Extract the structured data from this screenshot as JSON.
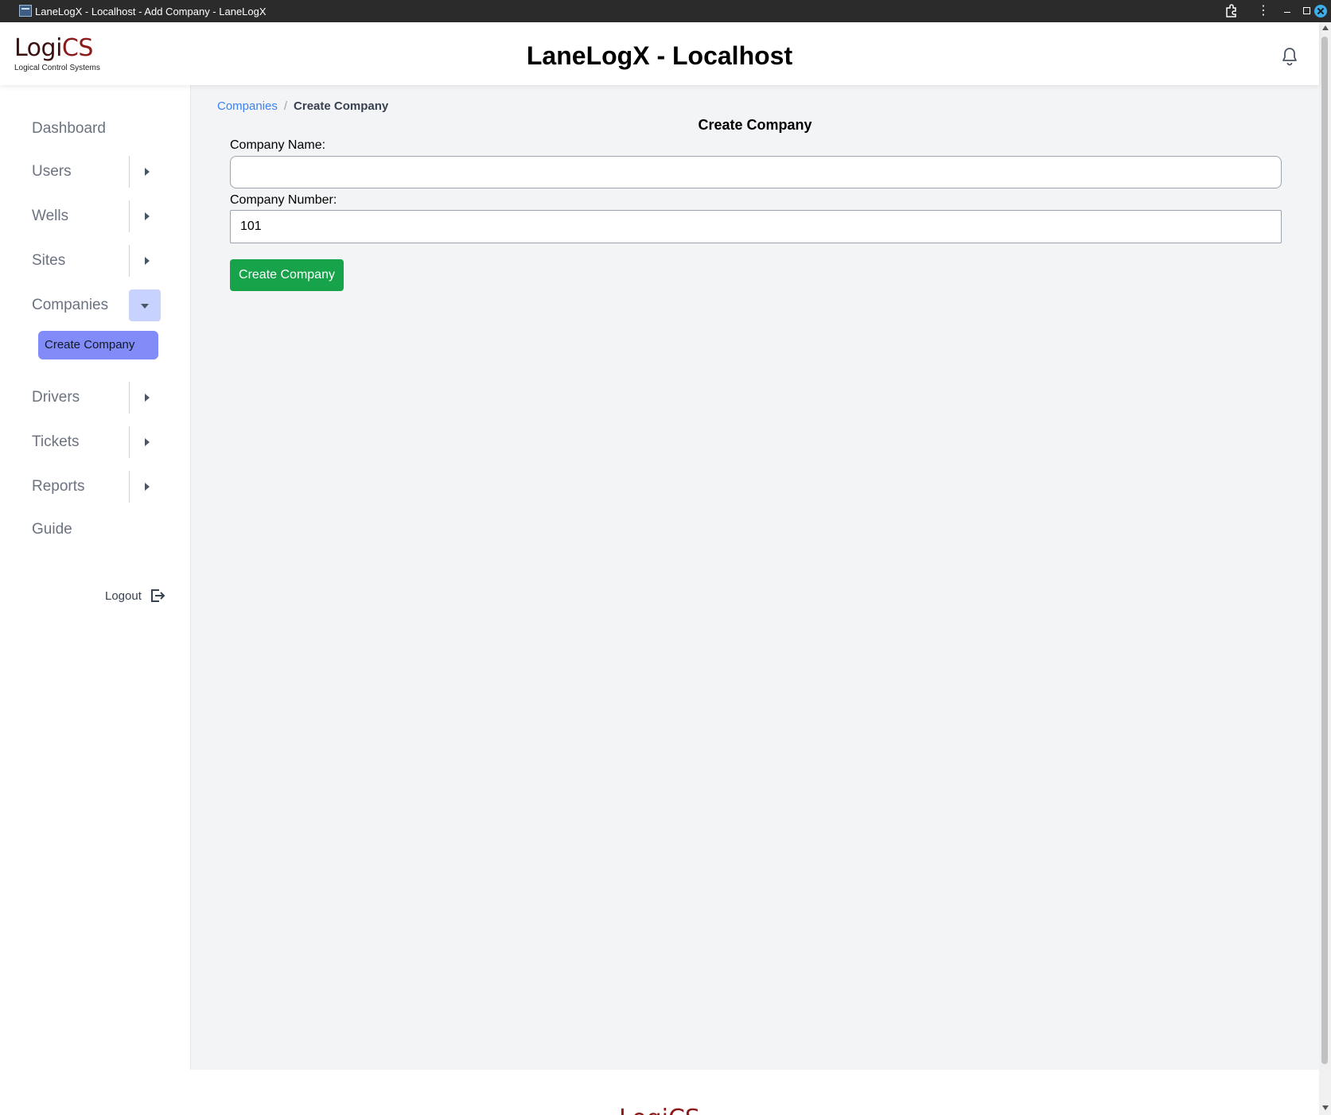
{
  "window": {
    "title": "LaneLogX - Localhost - Add Company - LaneLogX"
  },
  "header": {
    "logo_main": "Logi",
    "logo_accent": "CS",
    "logo_sub": "Logical Control Systems",
    "app_title": "LaneLogX - Localhost"
  },
  "sidebar": {
    "dashboard": "Dashboard",
    "users": "Users",
    "wells": "Wells",
    "sites": "Sites",
    "companies": "Companies",
    "create_company": "Create Company",
    "drivers": "Drivers",
    "tickets": "Tickets",
    "reports": "Reports",
    "guide": "Guide",
    "logout": "Logout"
  },
  "breadcrumb": {
    "parent": "Companies",
    "separator": "/",
    "current": "Create Company"
  },
  "form": {
    "title": "Create Company",
    "name_label": "Company Name:",
    "name_value": "",
    "number_label": "Company Number:",
    "number_value": "101",
    "submit_label": "Create Company"
  },
  "footer": {
    "logo": "LogiCS"
  },
  "colors": {
    "accent_green": "#16a34a",
    "submenu_active": "#818cf8",
    "toggle_open": "#c7d2fe",
    "link_blue": "#3b82f6",
    "brand_red": "#8b1a1a"
  },
  "icons": {
    "bell": "bell-icon",
    "logout": "logout-icon",
    "extensions": "puzzle-icon",
    "menu": "kebab-menu-icon"
  }
}
